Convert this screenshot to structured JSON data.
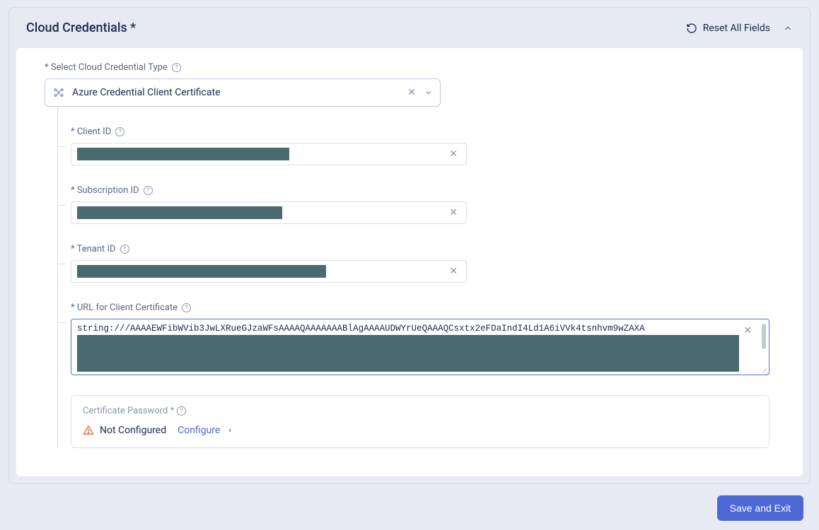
{
  "panel": {
    "title": "Cloud Credentials *",
    "reset_label": "Reset All Fields"
  },
  "fields": {
    "credential_type": {
      "label": "* Select Cloud Credential Type",
      "value": "Azure Credential Client Certificate"
    },
    "client_id": {
      "label": "* Client ID",
      "redacted_width": 300
    },
    "subscription_id": {
      "label": "* Subscription ID",
      "redacted_width": 290
    },
    "tenant_id": {
      "label": "* Tenant ID",
      "redacted_width": 352
    },
    "url_client_cert": {
      "label": "* URL for Client Certificate",
      "value": "string:///AAAAEWFibWVib3JwLXRueGJzaWFsAAAAQAAAAAAABlAgAAAAUDWYrUeQAAAQCsxtx2eFDaIndI4Ld1A6iVVk4tsnhvm9wZAXA"
    },
    "cert_password": {
      "label": "Certificate Password *",
      "status": "Not Configured",
      "action": "Configure"
    }
  },
  "footer": {
    "save_label": "Save and Exit"
  }
}
